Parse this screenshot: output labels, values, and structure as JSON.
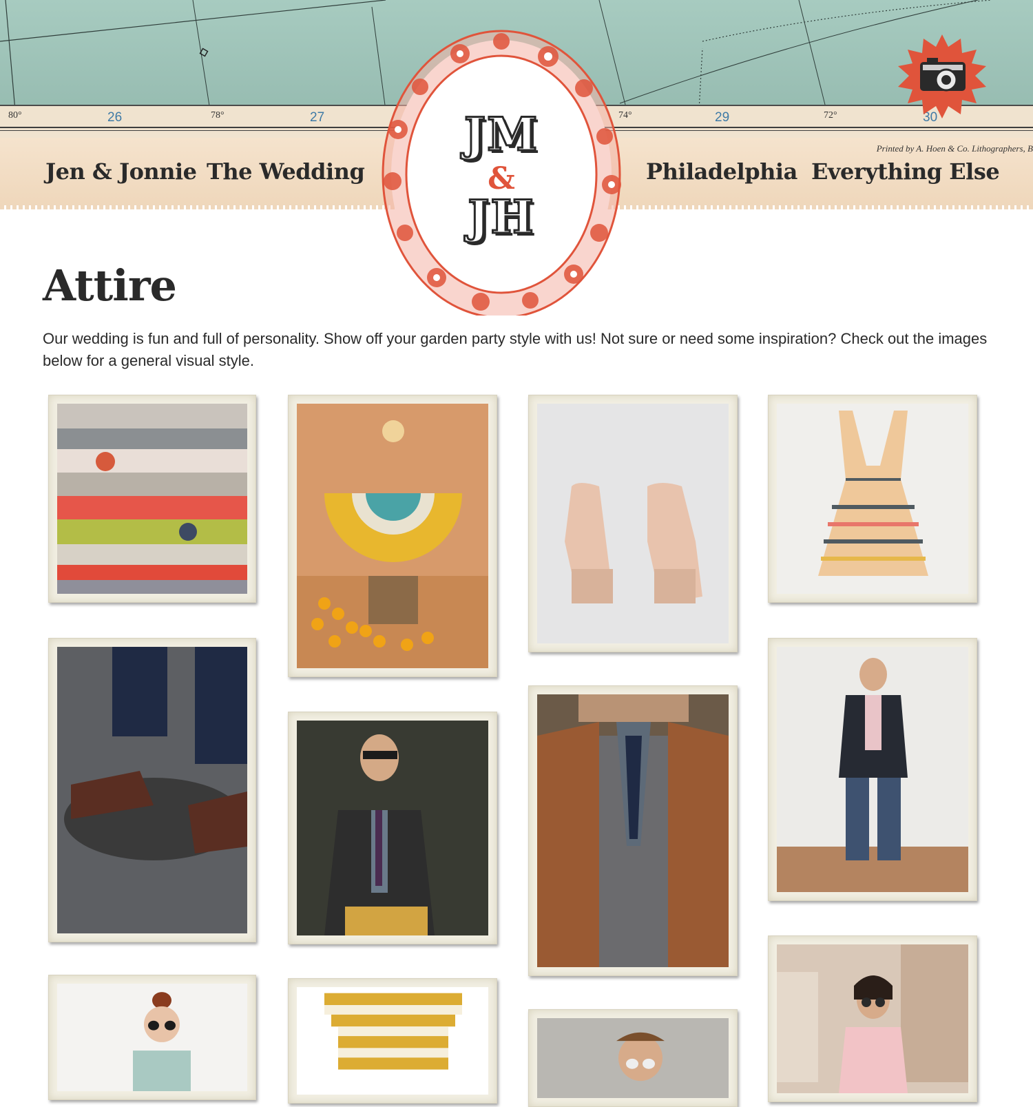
{
  "header": {
    "nav_left": [
      "Jen & Jonnie",
      "The Wedding"
    ],
    "nav_right": [
      "Philadelphia",
      "Everything Else"
    ],
    "printed_by": "Printed by A. Hoen & Co. Lithographers, B",
    "ruler_numbers": [
      "26",
      "27",
      "29",
      "30"
    ],
    "ruler_degrees": [
      "80°",
      "78°",
      "74°",
      "72°"
    ],
    "logo": {
      "line1": "JM",
      "amp": "&",
      "line2": "JH"
    },
    "accent_color": "#e0543b",
    "map_color": "#9fc3b8",
    "paper_color": "#f3dfc6"
  },
  "camera_badge": {
    "icon": "camera-icon",
    "color": "#e0543b"
  },
  "page": {
    "title": "Attire",
    "intro": "Our wedding is fun and full of personality. Show off your garden party style with us! Not sure or need some inspiration? Check out the images below for a general visual style."
  },
  "gallery": [
    {
      "subject": "stacked patterned fabrics"
    },
    {
      "subject": "woman in striped circle skirt on crate with oranges"
    },
    {
      "subject": "blush platform sandals"
    },
    {
      "subject": "striped sundress"
    },
    {
      "subject": "brown leather boots on manhole"
    },
    {
      "subject": "man in glasses with cardigan"
    },
    {
      "subject": "tweed vest with plaid shirt and tie"
    },
    {
      "subject": "man in blazer and jeans"
    },
    {
      "subject": "woman with top bun and round sunglasses"
    },
    {
      "subject": "yellow striped top"
    },
    {
      "subject": "man in sunglasses on street"
    },
    {
      "subject": "woman in pink shirt on city street"
    }
  ]
}
